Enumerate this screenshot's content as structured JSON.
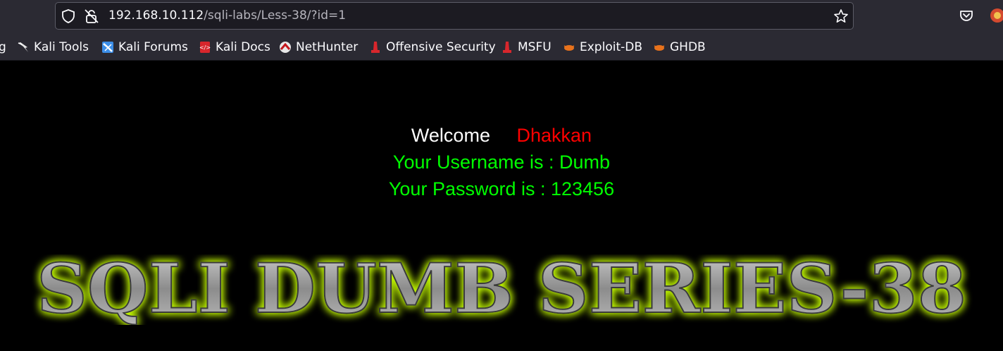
{
  "browser": {
    "url_host": "192.168.10.112",
    "url_path": "/sqli-labs/Less-38/?id=1",
    "icons": [
      "shield-icon",
      "lock-warning-icon",
      "star-icon",
      "pocket-icon",
      "extension-icon"
    ]
  },
  "bookmarks": [
    {
      "label": "g",
      "icon": "none"
    },
    {
      "label": "Kali Tools",
      "icon": "kali-dragon-icon"
    },
    {
      "label": "Kali Forums",
      "icon": "kali-forums-icon"
    },
    {
      "label": "Kali Docs",
      "icon": "kali-docs-icon"
    },
    {
      "label": "NetHunter",
      "icon": "nethunter-icon"
    },
    {
      "label": "Offensive Security",
      "icon": "offsec-icon"
    },
    {
      "label": "MSFU",
      "icon": "msfu-icon"
    },
    {
      "label": "Exploit-DB",
      "icon": "exploit-db-icon"
    },
    {
      "label": "GHDB",
      "icon": "ghdb-icon"
    }
  ],
  "content": {
    "welcome_label": "Welcome",
    "welcome_name": "Dhakkan",
    "username_line": "Your Username is : Dumb",
    "password_line": "Your Password is : 123456",
    "banner_text": "SQLI DUMB SERIES-38"
  },
  "colors": {
    "page_bg": "#000000",
    "welcome": "#ffffff",
    "name": "#ff0000",
    "result": "#00ff00",
    "banner_glow": "#c8ff00",
    "banner_fill": "#9a9a9a"
  }
}
